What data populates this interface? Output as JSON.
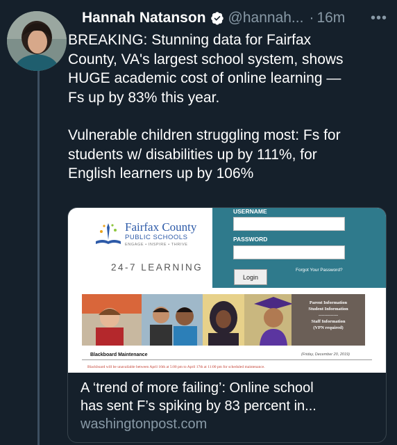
{
  "author": {
    "name": "Hannah Natanson",
    "handle": "@hannah...",
    "time": "16m",
    "separator": "·",
    "more": "•••"
  },
  "tweet": {
    "paragraph1": "BREAKING: Stunning data for Fairfax\nCounty, VA's largest school system, shows\nHUGE academic cost of online learning —\nFs up by 83% this year.",
    "paragraph2": "Vulnerable children struggling most: Fs for\nstudents w/ disabilities up by 111%, for\nEnglish learners up by 106%"
  },
  "card": {
    "title": "A ‘trend of more failing’: Online school\nhas sent F’s spiking by 83 percent in...",
    "domain": "washingtonpost.com",
    "image": {
      "logo_title": "Fairfax County",
      "logo_subtitle": "PUBLIC SCHOOLS",
      "logo_tagline": "ENGAGE • INSPIRE • THRIVE",
      "learning": "24-7 LEARNING",
      "username_label": "USERNAME",
      "password_label": "PASSWORD",
      "login_button": "Login",
      "forgot_password": "Forgot Your Password?",
      "info_lines": [
        "Parent Information",
        "Student Information",
        "-------------",
        "Staff Information",
        "(VPN required)"
      ],
      "maintenance_title": "Blackboard Maintenance",
      "maintenance_date": "(Friday, December 20, 2019)",
      "maintenance_notice": "Blackboard will be unavailable between April 16th at 5:00 pm to April 17th at 11:00 pm for scheduled maintenance."
    }
  },
  "colors": {
    "background": "#15202b",
    "secondary_text": "#8899a6",
    "verified": "#ffffff",
    "login_panel": "#2f7a8c"
  },
  "icons": [
    "verified-badge-icon",
    "more-options-icon"
  ]
}
